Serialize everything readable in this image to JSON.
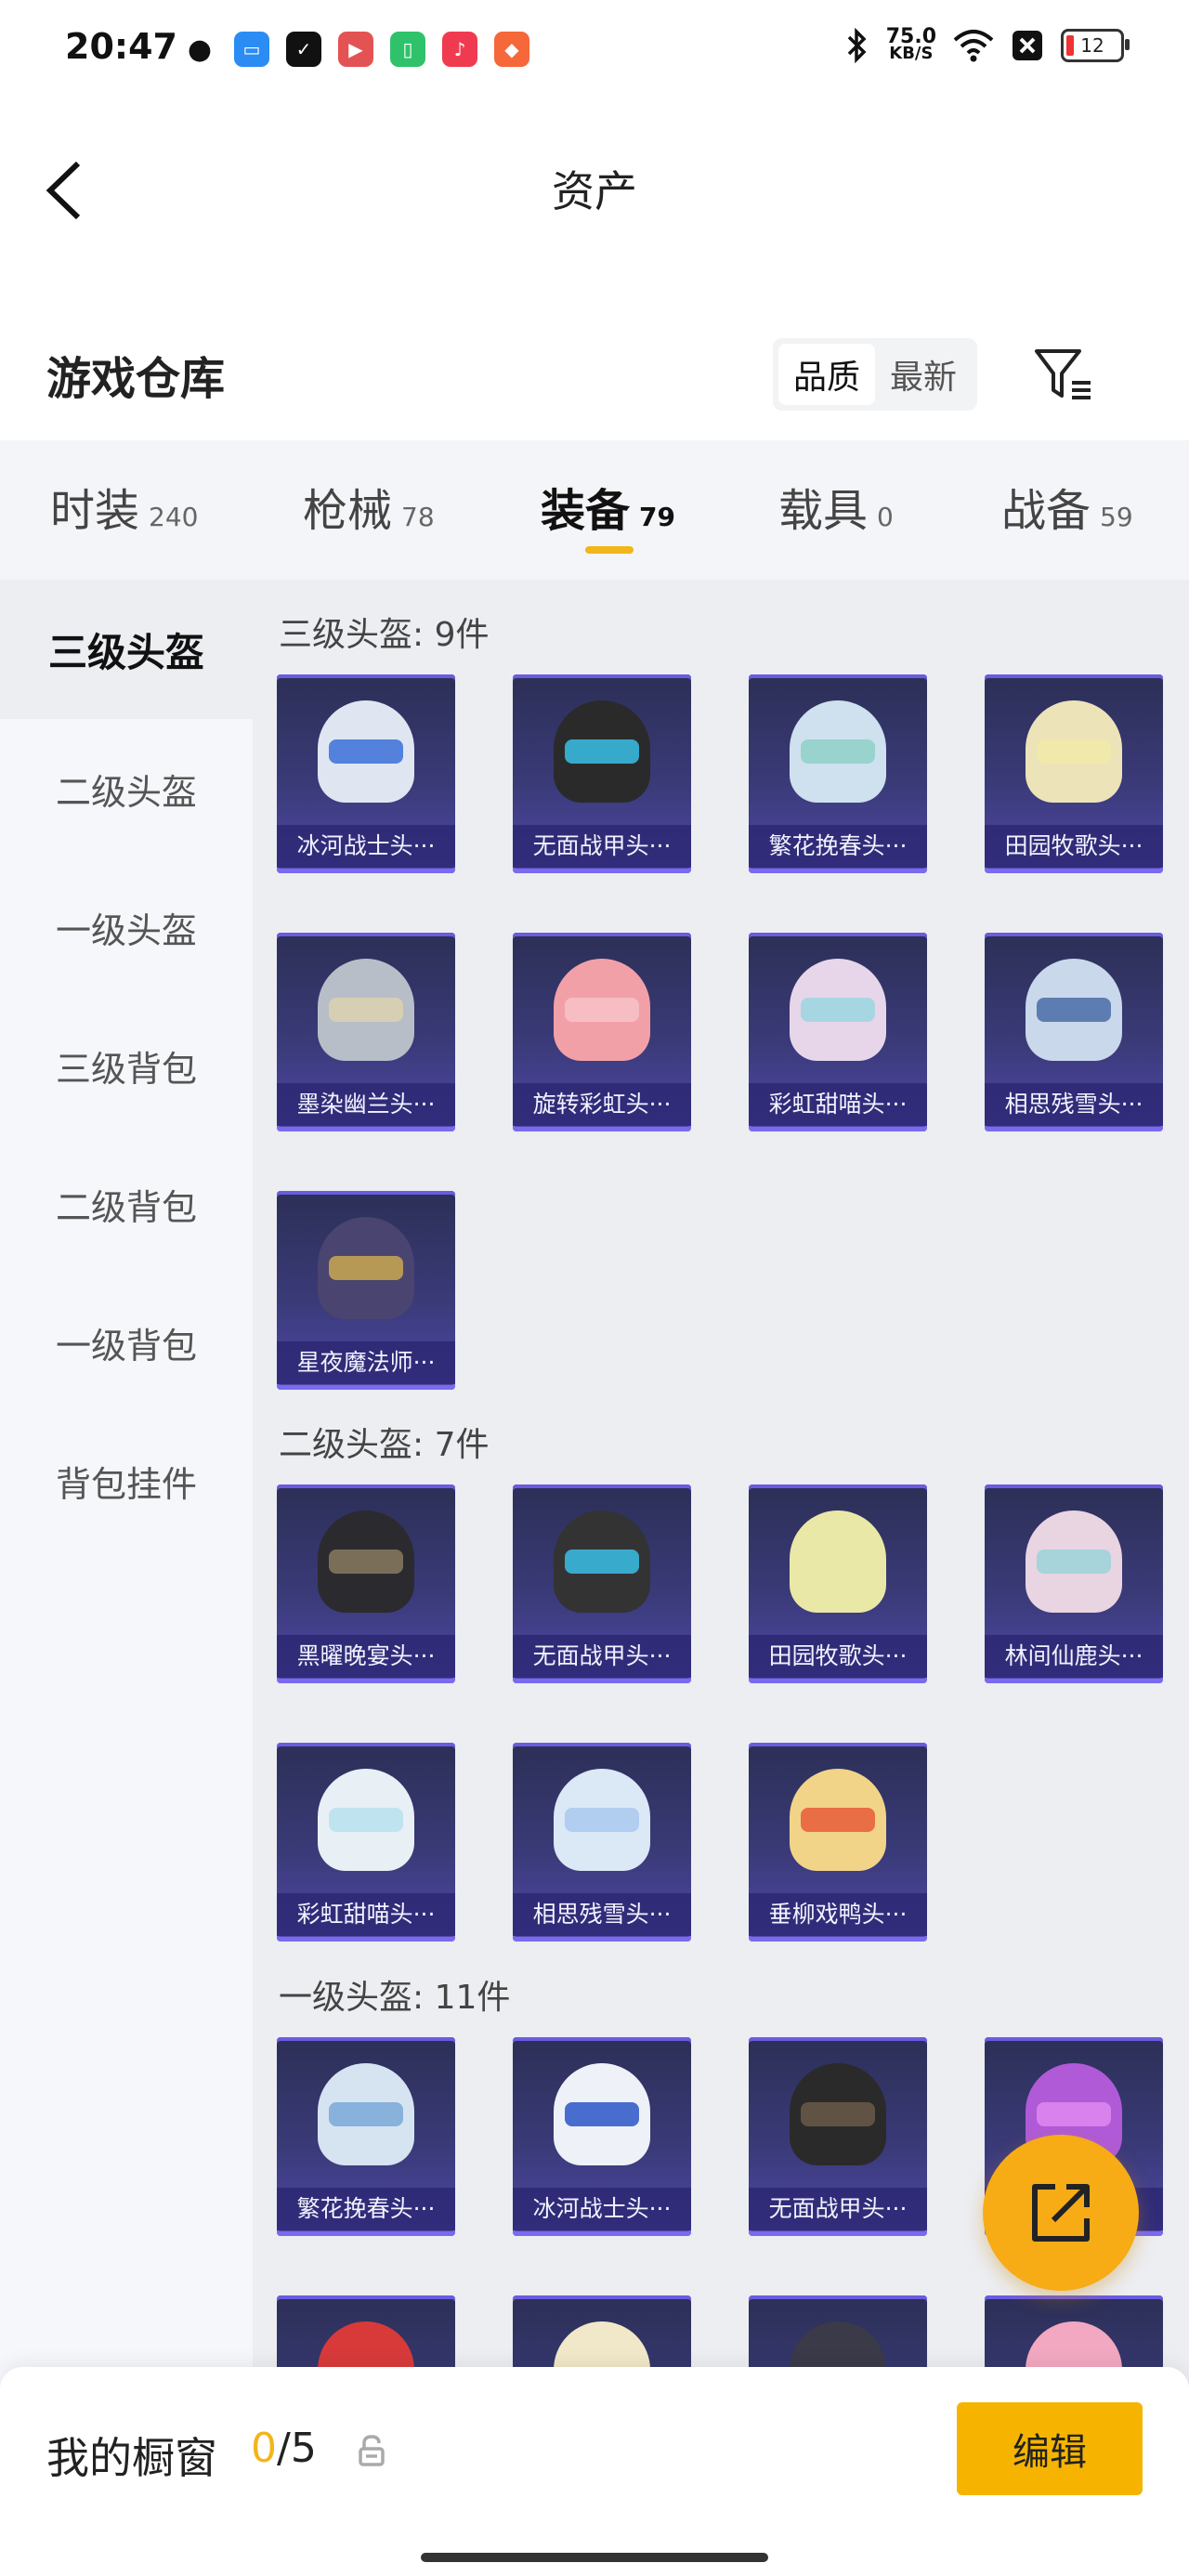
{
  "status_bar": {
    "time": "20:47",
    "net_speed_value": "75.0",
    "net_speed_unit": "KB/S",
    "battery": "12"
  },
  "header": {
    "title": "资产"
  },
  "section": {
    "title": "游戏仓库",
    "sort_options": [
      "品质",
      "最新"
    ],
    "active_sort": "品质"
  },
  "tabs": [
    {
      "label": "时装",
      "count": "240"
    },
    {
      "label": "枪械",
      "count": "78"
    },
    {
      "label": "装备",
      "count": "79"
    },
    {
      "label": "载具",
      "count": "0"
    },
    {
      "label": "战备",
      "count": "59"
    }
  ],
  "active_tab": "装备",
  "sidebar": [
    "三级头盔",
    "二级头盔",
    "一级头盔",
    "三级背包",
    "二级背包",
    "一级背包",
    "背包挂件"
  ],
  "active_sidebar": "三级头盔",
  "groups": [
    {
      "title": "三级头盔: 9件",
      "items": [
        "冰河战士头···",
        "无面战甲头···",
        "繁花挽春头···",
        "田园牧歌头···",
        "墨染幽兰头···",
        "旋转彩虹头···",
        "彩虹甜喵头···",
        "相思残雪头···",
        "星夜魔法师···"
      ]
    },
    {
      "title": "二级头盔: 7件",
      "items": [
        "黑曜晚宴头···",
        "无面战甲头···",
        "田园牧歌头···",
        "林间仙鹿头···",
        "彩虹甜喵头···",
        "相思残雪头···",
        "垂柳戏鸭头···"
      ]
    },
    {
      "title": "一级头盔: 11件",
      "items": [
        "繁花挽春头···",
        "冰河战士头···",
        "无面战甲头···",
        ""
      ]
    }
  ],
  "bottom": {
    "label": "我的橱窗",
    "current": "0",
    "total": "/5",
    "edit_label": "编辑"
  },
  "colors": {
    "accent": "#f6b400",
    "card_bg": "#3a3a78"
  }
}
